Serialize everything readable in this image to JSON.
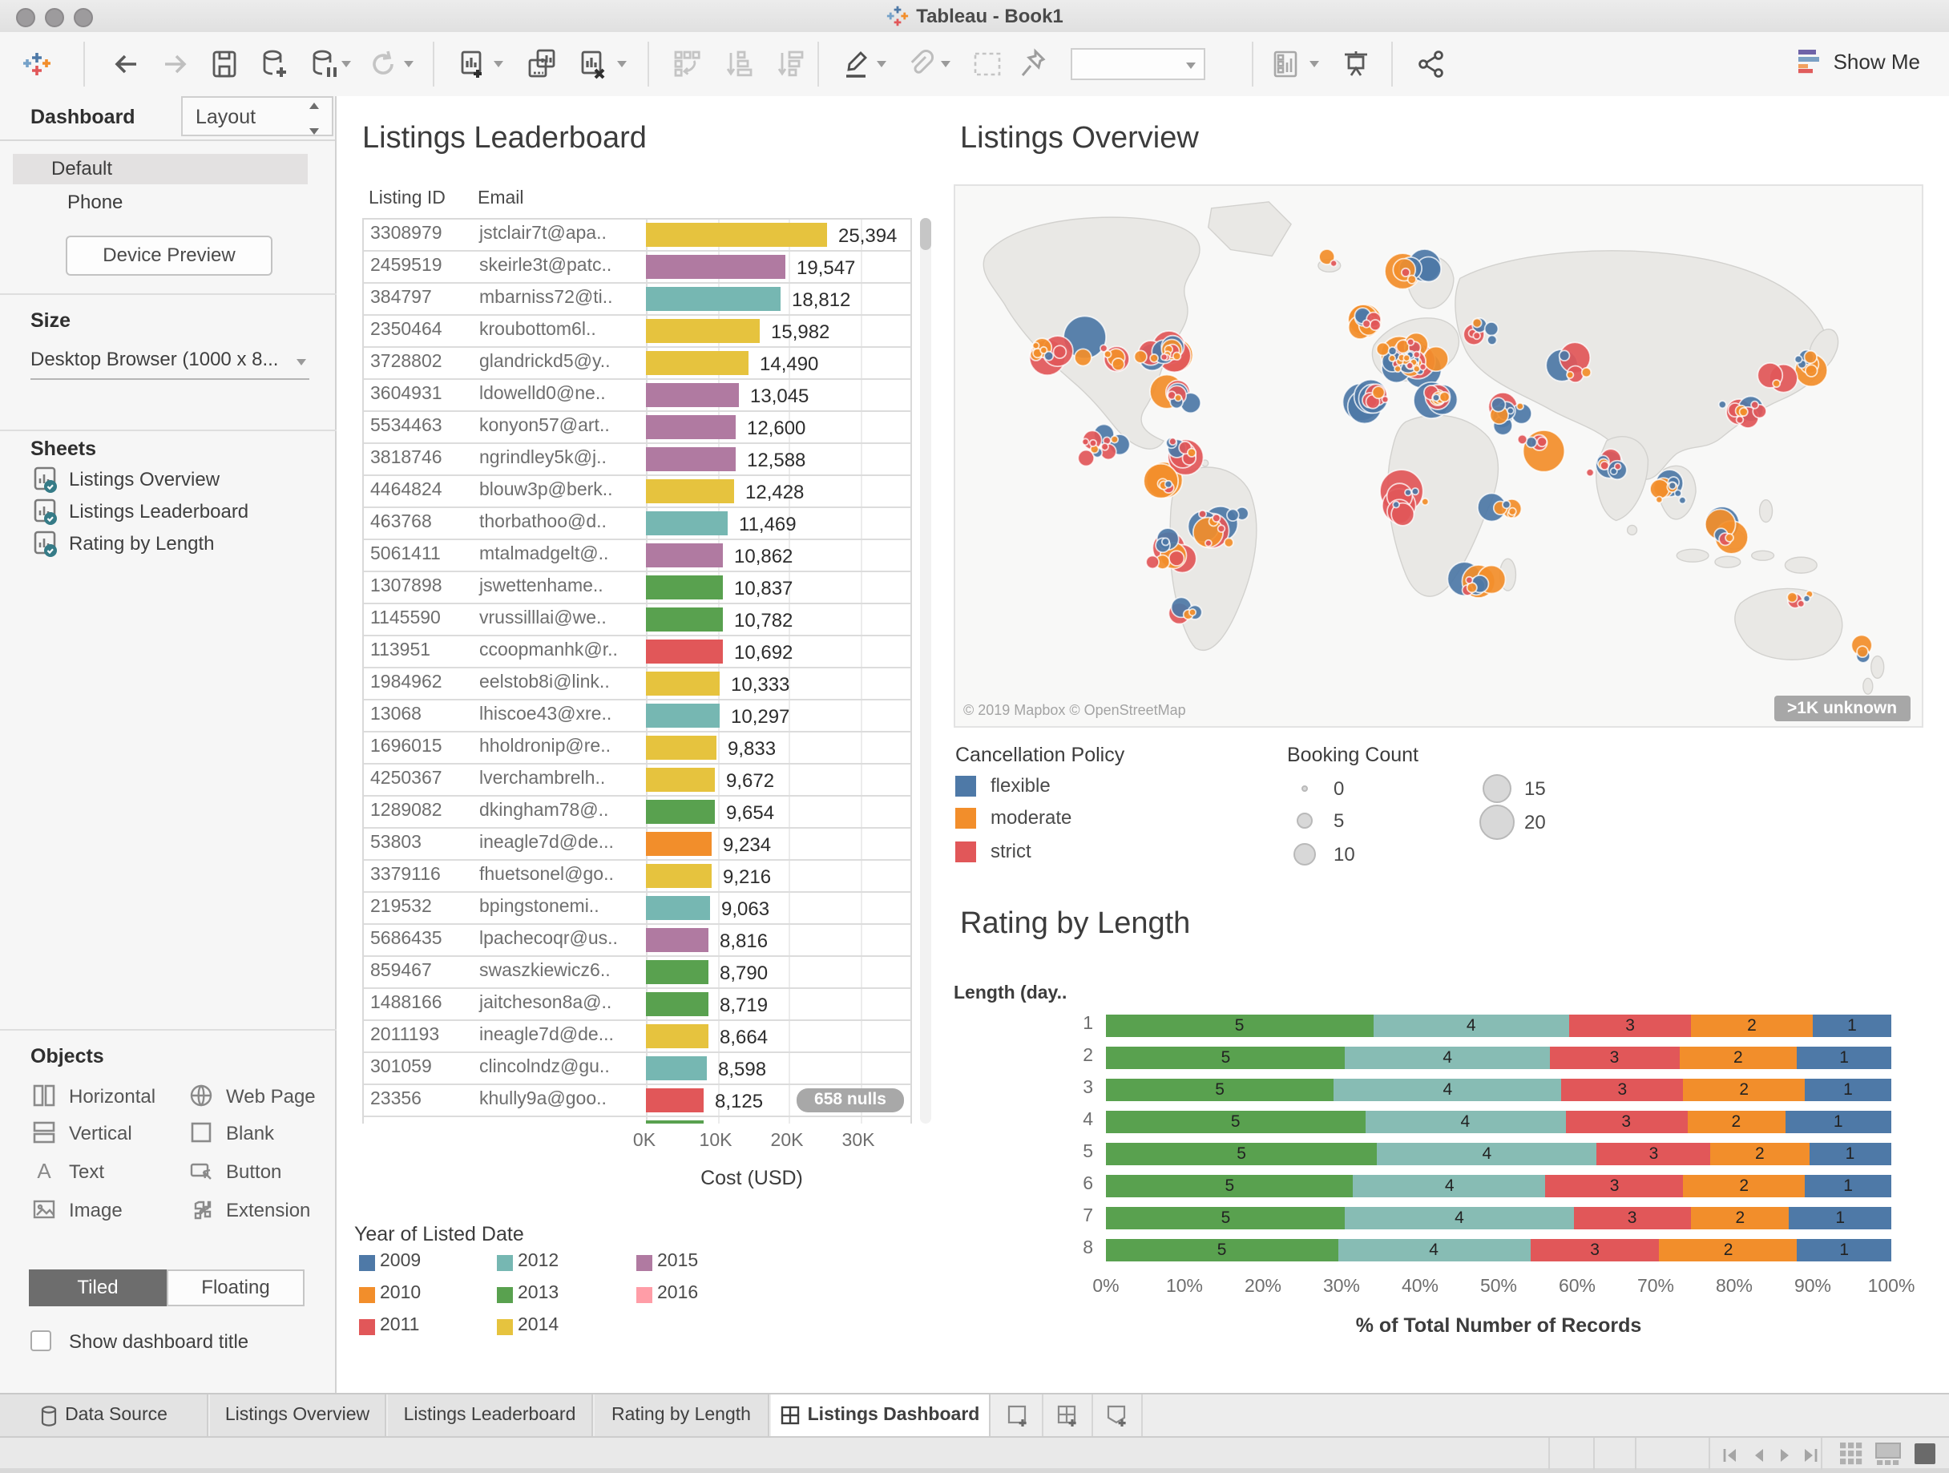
{
  "window": {
    "title": "Tableau - Book1"
  },
  "toolbar": {
    "show_me": "Show Me"
  },
  "sidebar": {
    "tab_dashboard": "Dashboard",
    "tab_layout": "Layout",
    "device_default": "Default",
    "device_phone": "Phone",
    "device_preview": "Device Preview",
    "size_label": "Size",
    "size_value": "Desktop Browser (1000 x 8...",
    "sheets_label": "Sheets",
    "sheets": [
      "Listings Overview",
      "Listings Leaderboard",
      "Rating by Length"
    ],
    "objects_label": "Objects",
    "objects": [
      {
        "label": "Horizontal",
        "icon": "horizontal-icon"
      },
      {
        "label": "Vertical",
        "icon": "vertical-icon"
      },
      {
        "label": "Text",
        "icon": "text-icon"
      },
      {
        "label": "Image",
        "icon": "image-icon"
      },
      {
        "label": "Web Page",
        "icon": "web-page-icon"
      },
      {
        "label": "Blank",
        "icon": "blank-icon"
      },
      {
        "label": "Button",
        "icon": "button-icon"
      },
      {
        "label": "Extension",
        "icon": "extension-icon"
      }
    ],
    "tiled": "Tiled",
    "floating": "Floating",
    "show_dashboard_title": "Show dashboard title"
  },
  "leaderboard": {
    "title": "Listings Leaderboard",
    "col_id": "Listing ID",
    "col_email": "Email",
    "axis_label": "Cost (USD)",
    "nulls_badge": "658 nulls",
    "legend_title": "Year of Listed Date",
    "legend": [
      {
        "label": "2009",
        "color": "#4E79A7"
      },
      {
        "label": "2010",
        "color": "#F28E2B"
      },
      {
        "label": "2011",
        "color": "#E15759"
      },
      {
        "label": "2012",
        "color": "#76B7B2"
      },
      {
        "label": "2013",
        "color": "#59A14F"
      },
      {
        "label": "2014",
        "color": "#E6C33E"
      },
      {
        "label": "2015",
        "color": "#B07AA1"
      },
      {
        "label": "2016",
        "color": "#FF9DA7"
      }
    ]
  },
  "overview": {
    "title": "Listings Overview",
    "attribution": "© 2019 Mapbox © OpenStreetMap",
    "badge": ">1K unknown",
    "cancellation_title": "Cancellation Policy",
    "cancellation": [
      {
        "label": "flexible",
        "color": "#4E79A7"
      },
      {
        "label": "moderate",
        "color": "#F28E2B"
      },
      {
        "label": "strict",
        "color": "#E15759"
      }
    ],
    "booking_title": "Booking Count",
    "booking": [
      {
        "label": "0",
        "r": 2
      },
      {
        "label": "5",
        "r": 5
      },
      {
        "label": "10",
        "r": 7
      },
      {
        "label": "15",
        "r": 9
      },
      {
        "label": "20",
        "r": 11
      }
    ]
  },
  "rating": {
    "title": "Rating by Length",
    "ylabel": "Length (day..",
    "xlabel": "% of Total Number of Records"
  },
  "tabbar": {
    "tabs": [
      {
        "label": "Data Source",
        "icon": "database-icon",
        "active": false
      },
      {
        "label": "Listings Overview",
        "icon": "",
        "active": false
      },
      {
        "label": "Listings Leaderboard",
        "icon": "",
        "active": false
      },
      {
        "label": "Rating by Length",
        "icon": "",
        "active": false
      },
      {
        "label": "Listings Dashboard",
        "icon": "dashboard-grid-icon",
        "active": true
      }
    ]
  },
  "chart_data": [
    {
      "type": "bar",
      "title": "Listings Leaderboard",
      "xlabel": "Cost (USD)",
      "xlim": [
        0,
        30000
      ],
      "x_ticks": [
        "0K",
        "10K",
        "20K",
        "30K"
      ],
      "columns": [
        "Listing ID",
        "Email"
      ],
      "annotation": "658 nulls",
      "year_colors": {
        "2009": "#4E79A7",
        "2010": "#F28E2B",
        "2011": "#E15759",
        "2012": "#76B7B2",
        "2013": "#59A14F",
        "2014": "#E6C33E",
        "2015": "#B07AA1",
        "2016": "#FF9DA7"
      },
      "rows": [
        [
          "3308979",
          "jstclair7t@apa..",
          25394,
          "25,394",
          "2014"
        ],
        [
          "2459519",
          "skeirle3t@patc..",
          19547,
          "19,547",
          "2015"
        ],
        [
          "384797",
          "mbarniss72@ti..",
          18812,
          "18,812",
          "2012"
        ],
        [
          "2350464",
          "kroubottom6l..",
          15982,
          "15,982",
          "2014"
        ],
        [
          "3728802",
          "glandrickd5@y..",
          14490,
          "14,490",
          "2014"
        ],
        [
          "3604931",
          "ldowelld0@ne..",
          13045,
          "13,045",
          "2015"
        ],
        [
          "5534463",
          "konyon57@art..",
          12600,
          "12,600",
          "2015"
        ],
        [
          "3818746",
          "ngrindley5k@j..",
          12588,
          "12,588",
          "2015"
        ],
        [
          "4464824",
          "blouw3p@berk..",
          12428,
          "12,428",
          "2014"
        ],
        [
          "463768",
          "thorbathoo@d..",
          11469,
          "11,469",
          "2012"
        ],
        [
          "5061411",
          "mtalmadgelt@..",
          10862,
          "10,862",
          "2015"
        ],
        [
          "1307898",
          "jswettenhame..",
          10837,
          "10,837",
          "2013"
        ],
        [
          "1145590",
          "vrussilllai@we..",
          10782,
          "10,782",
          "2013"
        ],
        [
          "113951",
          "ccoopmanhk@r..",
          10692,
          "10,692",
          "2011"
        ],
        [
          "1984962",
          "eelstob8i@link..",
          10333,
          "10,333",
          "2014"
        ],
        [
          "13068",
          "lhiscoe43@xre..",
          10297,
          "10,297",
          "2012"
        ],
        [
          "1696015",
          "hholdronip@re..",
          9833,
          "9,833",
          "2014"
        ],
        [
          "4250367",
          "lverchambrelh..",
          9672,
          "9,672",
          "2014"
        ],
        [
          "1289082",
          "dkingham78@..",
          9654,
          "9,654",
          "2013"
        ],
        [
          "53803",
          "ineagle7d@de...",
          9234,
          "9,234",
          "2010"
        ],
        [
          "3379116",
          "fhuetsonel@go..",
          9216,
          "9,216",
          "2014"
        ],
        [
          "219532",
          "bpingstonemi..",
          9063,
          "9,063",
          "2012"
        ],
        [
          "5686435",
          "lpachecoqr@us..",
          8816,
          "8,816",
          "2015"
        ],
        [
          "859467",
          "swaszkiewicz6..",
          8790,
          "8,790",
          "2013"
        ],
        [
          "1488166",
          "jaitcheson8a@..",
          8719,
          "8,719",
          "2013"
        ],
        [
          "2011193",
          "ineagle7d@de...",
          8664,
          "8,664",
          "2014"
        ],
        [
          "301059",
          "clincolndz@gu..",
          8598,
          "8,598",
          "2012"
        ],
        [
          "23356",
          "khully9a@goo..",
          8125,
          "8,125",
          "2011"
        ]
      ],
      "partial_row": {
        "year": "2013",
        "value": 8050
      }
    },
    {
      "type": "scatter",
      "title": "Listings Overview",
      "map_attribution": "© 2019 Mapbox © OpenStreetMap",
      "badge": ">1K unknown",
      "legend_colors": {
        "flexible": "#4E79A7",
        "moderate": "#F28E2B",
        "strict": "#E15759"
      },
      "size_legend": [
        0,
        5,
        10,
        15,
        20
      ],
      "clusters": [
        [
          9,
          31,
          9,
          2.5
        ],
        [
          15,
          31,
          7,
          3
        ],
        [
          21,
          31,
          16,
          3
        ],
        [
          23,
          39,
          8,
          2
        ],
        [
          15,
          48,
          12,
          3
        ],
        [
          23,
          49,
          8,
          2
        ],
        [
          22,
          55,
          6,
          2
        ],
        [
          27,
          63,
          12,
          3.5
        ],
        [
          22,
          68,
          9,
          2.5
        ],
        [
          24,
          79,
          5,
          2
        ],
        [
          39,
          14,
          2,
          1
        ],
        [
          42.5,
          25,
          9,
          1.8
        ],
        [
          47,
          16,
          7,
          2.5
        ],
        [
          47,
          32,
          38,
          3.5
        ],
        [
          43.5,
          40,
          9,
          2
        ],
        [
          50,
          39,
          9,
          2
        ],
        [
          54,
          27,
          7,
          3
        ],
        [
          57,
          43,
          9,
          3
        ],
        [
          60,
          48,
          5,
          2
        ],
        [
          64,
          33,
          6,
          3
        ],
        [
          68,
          52,
          9,
          2.5
        ],
        [
          74,
          57,
          9,
          3
        ],
        [
          80,
          64,
          6,
          3
        ],
        [
          81,
          42,
          10,
          3
        ],
        [
          88,
          33,
          7,
          2
        ],
        [
          85,
          36,
          3,
          1.5
        ],
        [
          47,
          58,
          9,
          3
        ],
        [
          57,
          60,
          6,
          2.5
        ],
        [
          54,
          74,
          8,
          2.5
        ],
        [
          88,
          76,
          5,
          2.5
        ],
        [
          94,
          86,
          3,
          1.5
        ]
      ]
    },
    {
      "type": "bar",
      "subtype": "stacked-horizontal",
      "title": "Rating by Length",
      "ylabel": "Length (day..",
      "xlabel": "% of Total Number of Records",
      "categories": [
        "1",
        "2",
        "3",
        "4",
        "5",
        "6",
        "7",
        "8"
      ],
      "series_order": [
        "5",
        "4",
        "3",
        "2",
        "1"
      ],
      "series_colors": {
        "5": "#59A14F",
        "4": "#87BCB4",
        "3": "#E15759",
        "2": "#F28E2B",
        "1": "#4E79A7"
      },
      "x_ticks": [
        "0%",
        "10%",
        "20%",
        "30%",
        "40%",
        "50%",
        "60%",
        "70%",
        "80%",
        "90%",
        "100%"
      ],
      "rows": [
        [
          34,
          25,
          15.5,
          15.5,
          10
        ],
        [
          30.5,
          26,
          16.5,
          15,
          12
        ],
        [
          29,
          29,
          15.5,
          15.5,
          11
        ],
        [
          33,
          25.5,
          15.5,
          12.5,
          13.5
        ],
        [
          34.5,
          28,
          14.5,
          12.5,
          10.5
        ],
        [
          31.5,
          24.5,
          17.5,
          15.5,
          11
        ],
        [
          30.5,
          29,
          15,
          12.5,
          13
        ],
        [
          29.5,
          24.5,
          16.5,
          17.5,
          12
        ]
      ]
    }
  ]
}
